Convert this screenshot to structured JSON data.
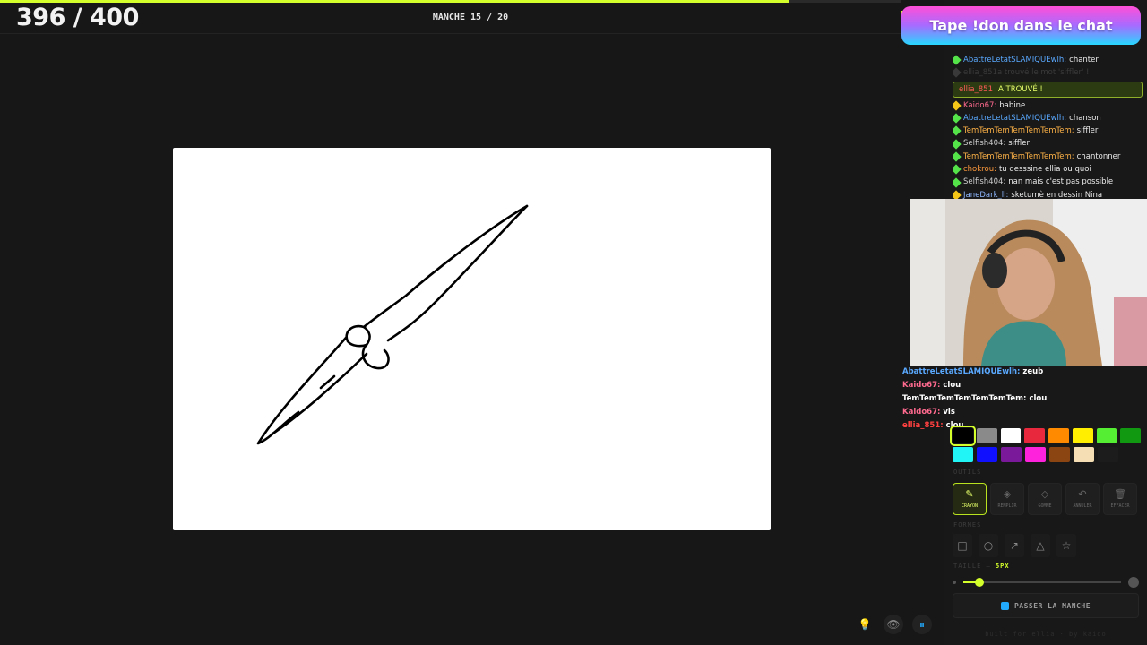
{
  "header": {
    "score": "396 / 400",
    "round": "MANCHE 15 / 20",
    "progress_fraction": 0.99
  },
  "banner": {
    "text": "Tape !don dans le chat"
  },
  "chat": [
    {
      "user": "AbattreLetatSLAMIQUEwlh:",
      "text": "chanter",
      "color": "#5aa9ff",
      "gem": "#55e34a",
      "faded": false
    },
    {
      "user": "ellia_851a trouvé le mot 'siffler' !",
      "text": "",
      "color": "#777777",
      "gem": "#777777",
      "faded": true
    },
    {
      "user": "Kaido67:",
      "text": "babine",
      "color": "#ff6a8f",
      "gem": "#f5c518",
      "faded": false
    },
    {
      "user": "AbattreLetatSLAMIQUEwlh:",
      "text": "chanson",
      "color": "#5aa9ff",
      "gem": "#55e34a",
      "faded": false
    },
    {
      "user": "TemTemTemTemTemTemTem:",
      "text": "siffler",
      "color": "#ffb347",
      "gem": "#55e34a",
      "faded": false
    },
    {
      "user": "Selfish404:",
      "text": "siffler",
      "color": "#cfcfcf",
      "gem": "#55e34a",
      "faded": false
    },
    {
      "user": "TemTemTemTemTemTemTem:",
      "text": "chantonner",
      "color": "#ffb347",
      "gem": "#55e34a",
      "faded": false
    },
    {
      "user": "chokrou:",
      "text": "tu desssine ellia ou quoi",
      "color": "#ff9a3c",
      "gem": "#55e34a",
      "faded": false
    },
    {
      "user": "Selfish404:",
      "text": "nan mais c'est pas possible",
      "color": "#cfcfcf",
      "gem": "#55e34a",
      "faded": false
    },
    {
      "user": "JaneDark_ll:",
      "text": "sketumè en dessin Nina",
      "color": "#8fb8ff",
      "gem": "#f5c518",
      "faded": false
    }
  ],
  "found_notice": {
    "user": "ellia_851",
    "text": "A TROUVÉ !"
  },
  "overlay_chat": [
    {
      "user": "AbattreLetatSLAMIQUEwlh:",
      "text": "zeub",
      "color": "#5aa9ff"
    },
    {
      "user": "Kaido67:",
      "text": "clou",
      "color": "#ff6a8f"
    },
    {
      "user": "TemTemTemTemTemTemTem:",
      "text": "clou",
      "color": "#ffffff"
    },
    {
      "user": "Kaido67:",
      "text": "vis",
      "color": "#ff6a8f"
    },
    {
      "user": "ellia_851:",
      "text": "clou",
      "color": "#ff4040"
    }
  ],
  "colors": {
    "row1": [
      "#000000",
      "#8a8a8a",
      "#ffffff",
      "#e8283c",
      "#ff8a00",
      "#ffee00",
      "#55ee33",
      "#119911"
    ],
    "row2": [
      "#22f5f5",
      "#1010ff",
      "#7a1a9a",
      "#ff22dd",
      "#8b4513",
      "#f5deb3",
      "#1c1c1c"
    ],
    "selected": "#000000"
  },
  "tools": [
    {
      "label": "CRAYON",
      "icon": "✎",
      "active": true
    },
    {
      "label": "REMPLIR",
      "icon": "◈",
      "active": false
    },
    {
      "label": "GOMME",
      "icon": "◇",
      "active": false
    },
    {
      "label": "ANNULER",
      "icon": "↶",
      "active": false
    },
    {
      "label": "EFFACER",
      "icon": "🗑",
      "active": false
    }
  ],
  "shapes": [
    "□",
    "○",
    "↗",
    "△",
    "☆"
  ],
  "size": {
    "label": "TAILLE —",
    "value": "5PX",
    "fraction": 0.08
  },
  "skip_label": "PASSER LA MANCHE",
  "credit": "built for ellia · by kaido"
}
